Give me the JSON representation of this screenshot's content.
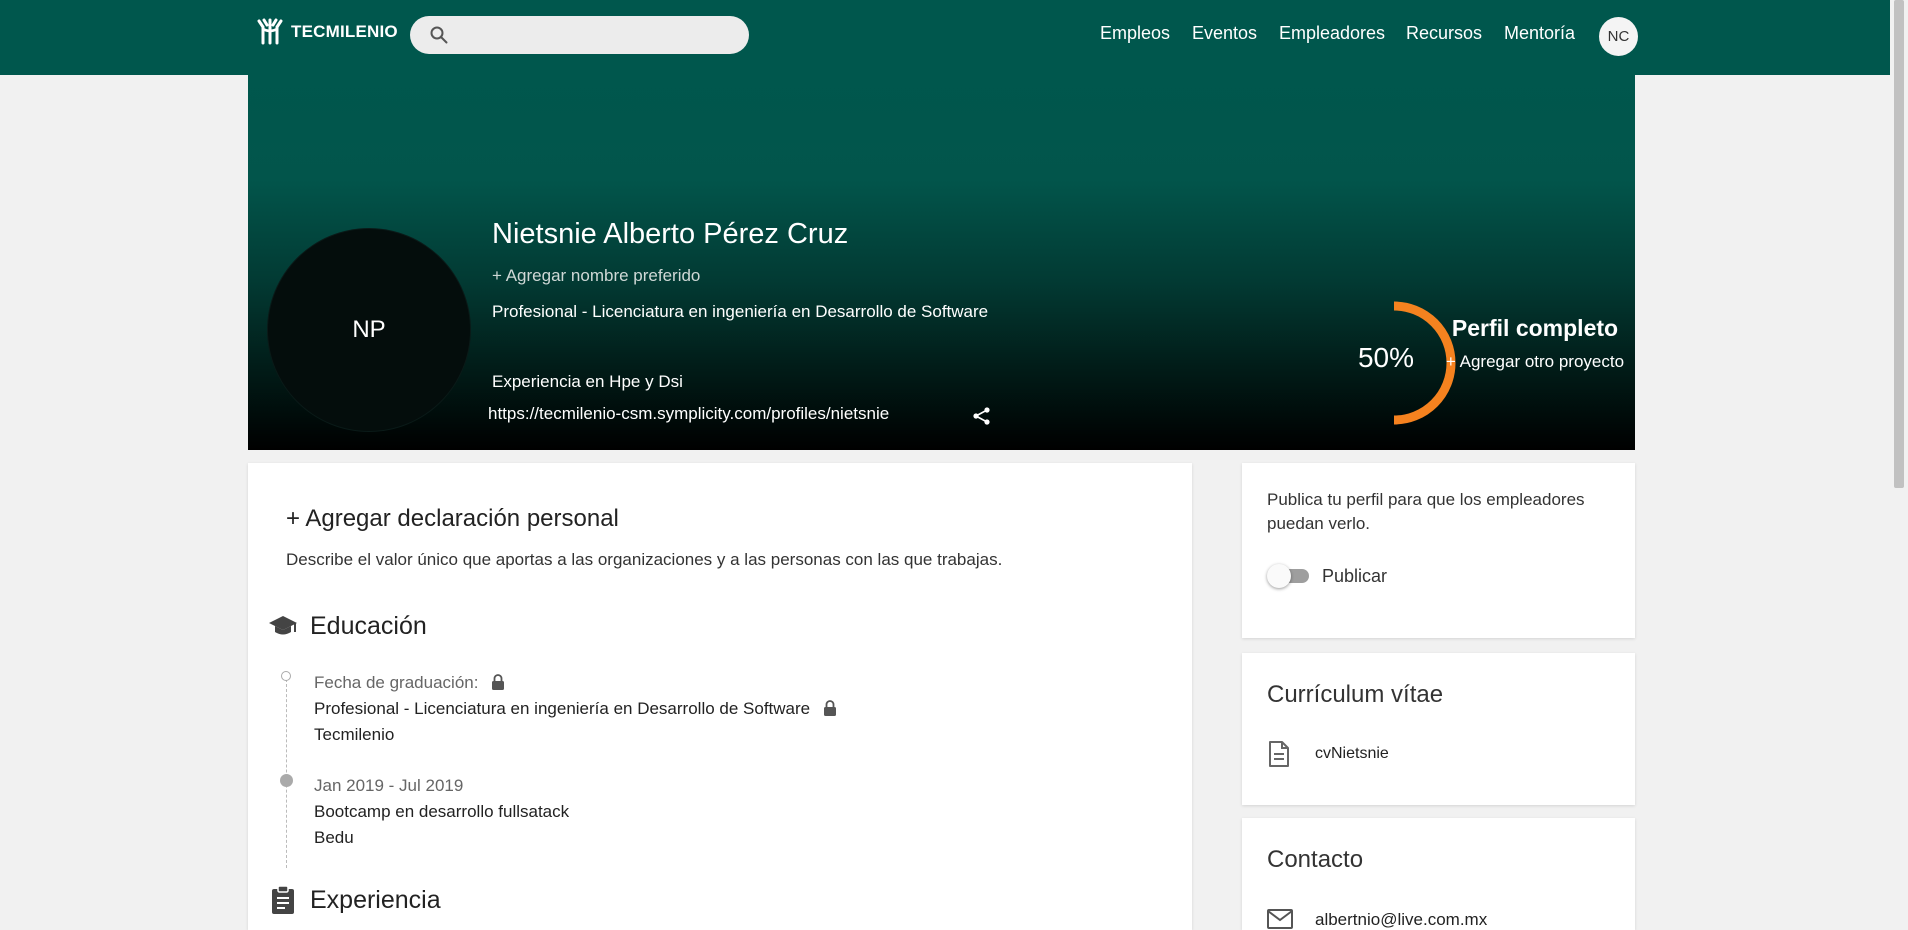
{
  "header": {
    "logo_text": "TECMILENIO",
    "search": {
      "placeholder": "",
      "value": ""
    },
    "nav": [
      "Empleos",
      "Eventos",
      "Empleadores",
      "Recursos",
      "Mentoría"
    ],
    "user_initials": "NC"
  },
  "profile": {
    "initials": "NP",
    "name": "Nietsnie Alberto Pérez Cruz",
    "add_preferred_name": "+ Agregar nombre preferido",
    "program": "Profesional - Licenciatura en ingeniería en Desarrollo de Software",
    "experience": "Experiencia en Hpe y Dsi",
    "url": "https://tecmilenio-csm.symplicity.com/profiles/nietsnie",
    "completion": {
      "percent": 50,
      "percent_label": "50%",
      "title": "Perfil completo",
      "action": "+ Agregar otro proyecto",
      "color": "#f5821f"
    }
  },
  "personal_statement": {
    "title": "+ Agregar declaración personal",
    "description": "Describe el valor único que aportas a las organizaciones y a las personas con las que trabajas."
  },
  "education": {
    "title": "Educación",
    "items": [
      {
        "date": "Fecha de graduación:",
        "degree": "Profesional  - Licenciatura en ingeniería en Desarrollo de Software",
        "school": "Tecmilenio"
      },
      {
        "date": "Jan 2019 - Jul 2019",
        "degree": "Bootcamp en desarrollo fullsatack",
        "school": "Bedu"
      }
    ]
  },
  "experience_section": {
    "title": "Experiencia"
  },
  "publish": {
    "text": "Publica tu perfil para que los empleadores puedan verlo.",
    "toggle_label": "Publicar"
  },
  "cv": {
    "title": "Currículum vítae",
    "file": "cvNietsnie"
  },
  "contact": {
    "title": "Contacto",
    "email": "albertnio@live.com.mx"
  }
}
